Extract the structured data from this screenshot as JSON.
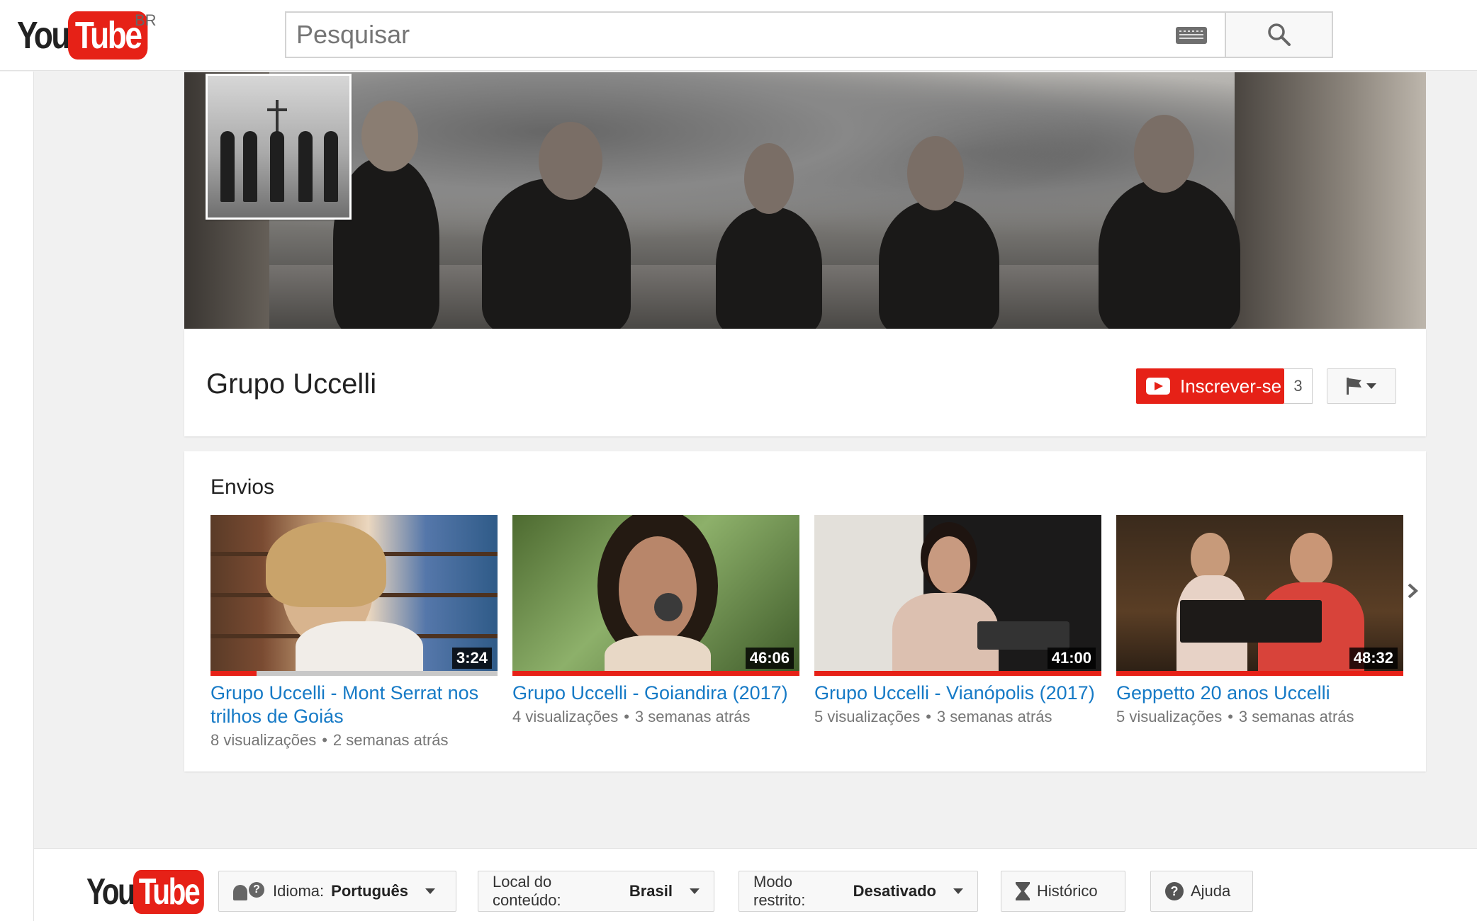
{
  "masthead": {
    "logo_you": "You",
    "logo_tube": "Tube",
    "region": "BR",
    "search_placeholder": "Pesquisar"
  },
  "channel": {
    "title": "Grupo Uccelli",
    "subscribe_label": "Inscrever-se",
    "subscriber_count": "3"
  },
  "shelf": {
    "title": "Envios",
    "videos": [
      {
        "title": "Grupo Uccelli - Mont Serrat nos trilhos de Goiás",
        "duration": "3:24",
        "views": "8 visualizações",
        "age": "2 semanas atrás",
        "watched_fraction": 0.16
      },
      {
        "title": "Grupo Uccelli - Goiandira (2017)",
        "duration": "46:06",
        "views": "4 visualizações",
        "age": "3 semanas atrás",
        "watched_fraction": 1
      },
      {
        "title": "Grupo Uccelli - Vianópolis (2017)",
        "duration": "41:00",
        "views": "5 visualizações",
        "age": "3 semanas atrás",
        "watched_fraction": 1
      },
      {
        "title": "Geppetto 20 anos Uccelli",
        "duration": "48:32",
        "views": "5 visualizações",
        "age": "3 semanas atrás",
        "watched_fraction": 1
      }
    ],
    "separator": "•"
  },
  "footer": {
    "logo_you": "You",
    "logo_tube": "Tube",
    "language_label": "Idioma:",
    "language_value": "Português",
    "location_label": "Local do conteúdo:",
    "location_value": "Brasil",
    "restricted_label": "Modo restrito:",
    "restricted_value": "Desativado",
    "history_label": "Histórico",
    "help_label": "Ajuda"
  },
  "colors": {
    "brand_red": "#e62117",
    "link_blue": "#167ac6"
  }
}
